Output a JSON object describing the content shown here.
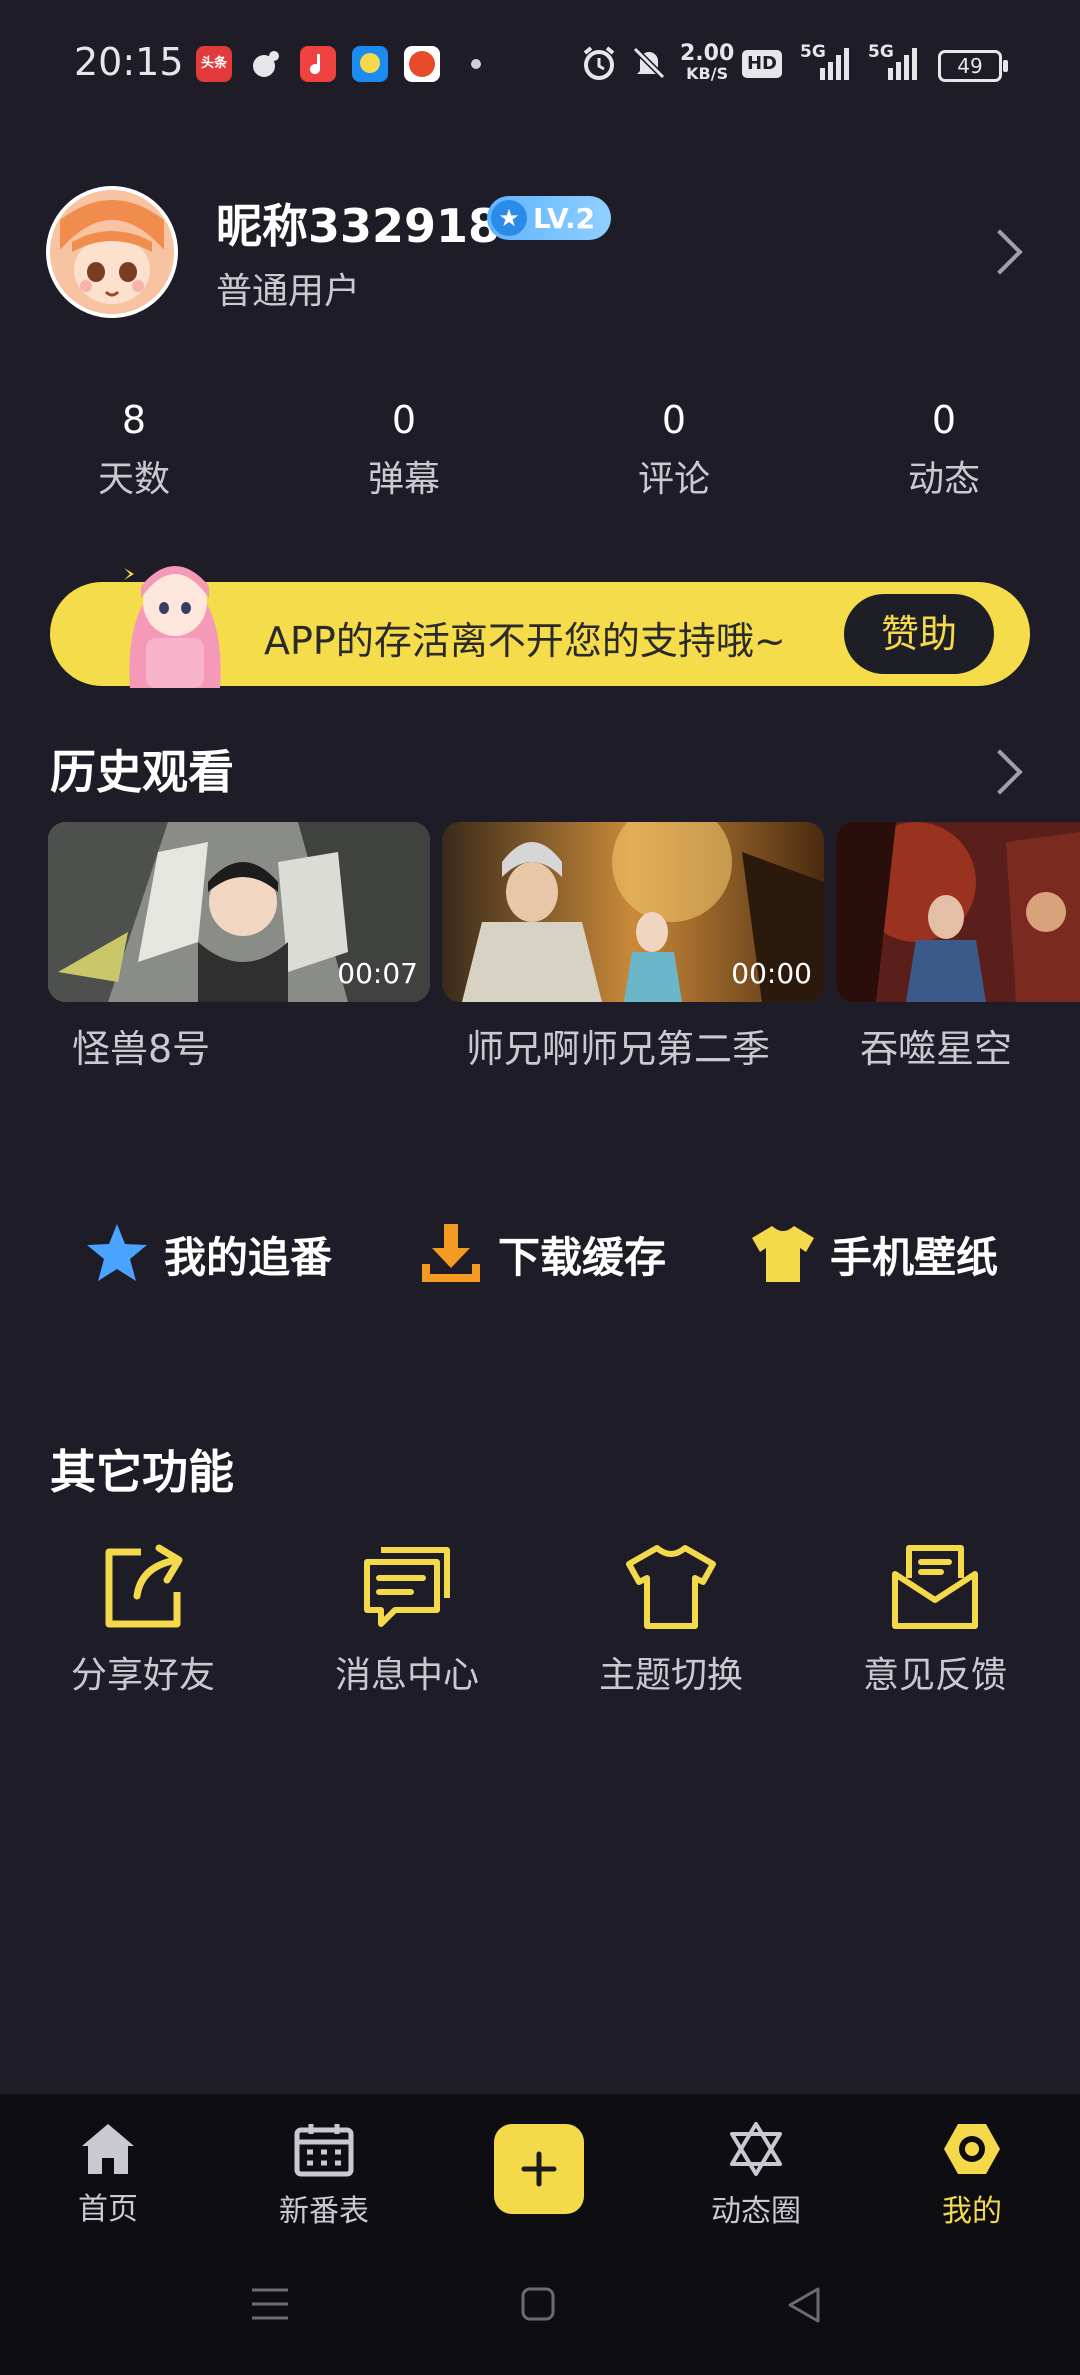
{
  "status_bar": {
    "time": "20:15",
    "apps": [
      {
        "name": "toutiao-icon",
        "label": "头条",
        "color": "#e33b3b"
      },
      {
        "name": "weibo-icon",
        "label": "",
        "color": "#e6e6ea"
      },
      {
        "name": "music-app-icon",
        "label": "",
        "color": "#f04141"
      },
      {
        "name": "chat-app-icon",
        "label": "",
        "color": "#1c8bf0"
      },
      {
        "name": "shop-app-icon",
        "label": "",
        "color": "#e64b2b"
      }
    ],
    "net_speed": "2.00",
    "net_unit": "KB/S",
    "hd_label": "HD",
    "signal_1": "5G",
    "signal_2": "5G",
    "battery": "49"
  },
  "profile": {
    "nickname": "昵称332918",
    "level": "LV.2",
    "user_type": "普通用户"
  },
  "stats": [
    {
      "value": "8",
      "label": "天数"
    },
    {
      "value": "0",
      "label": "弹幕"
    },
    {
      "value": "0",
      "label": "评论"
    },
    {
      "value": "0",
      "label": "动态"
    }
  ],
  "banner": {
    "text": "APP的存活离不开您的支持哦~",
    "button": "赞助"
  },
  "history": {
    "title": "历史观看",
    "items": [
      {
        "title": "怪兽8号",
        "duration": "00:07"
      },
      {
        "title": "师兄啊师兄第二季",
        "duration": "00:00"
      },
      {
        "title": "吞噬星空",
        "duration": ""
      }
    ]
  },
  "quick_actions": [
    {
      "label": "我的追番",
      "icon": "star-icon",
      "color": "#4aa3ff"
    },
    {
      "label": "下载缓存",
      "icon": "download-icon",
      "color": "#f59a23"
    },
    {
      "label": "手机壁纸",
      "icon": "tshirt-icon",
      "color": "#f4d94a"
    }
  ],
  "other_functions": {
    "title": "其它功能",
    "items": [
      {
        "label": "分享好友",
        "icon": "share-icon"
      },
      {
        "label": "消息中心",
        "icon": "message-icon"
      },
      {
        "label": "主题切换",
        "icon": "tshirt-outline-icon"
      },
      {
        "label": "意见反馈",
        "icon": "mail-icon"
      }
    ]
  },
  "nav": {
    "items": [
      {
        "label": "首页",
        "icon": "home-icon"
      },
      {
        "label": "新番表",
        "icon": "calendar-icon"
      },
      {
        "label": "动态圈",
        "icon": "hexagram-icon"
      },
      {
        "label": "我的",
        "icon": "profile-icon"
      }
    ],
    "active_color": "#f4d94a",
    "accent": "#f4d94a"
  }
}
